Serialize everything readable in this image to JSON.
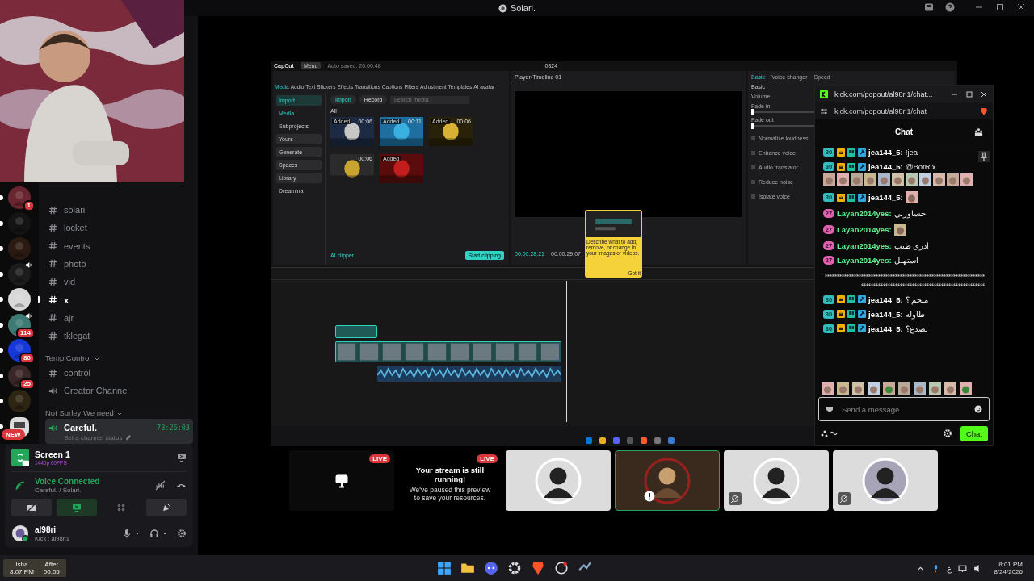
{
  "title_bar": {
    "title": "Solari."
  },
  "servers": [
    {
      "kind": "avatar",
      "badge": "1",
      "speaking": false
    },
    {
      "kind": "avatar",
      "speaking": false
    },
    {
      "kind": "avatar",
      "speaking": false
    },
    {
      "kind": "avatar",
      "speaking": true
    },
    {
      "kind": "avatar",
      "speaking": false
    },
    {
      "kind": "avatar",
      "badge": "114",
      "speaking": true
    },
    {
      "kind": "avatar",
      "badge": "80",
      "speaking": false
    },
    {
      "kind": "avatar",
      "badge": "25",
      "speaking": false
    },
    {
      "kind": "avatar",
      "speaking": false
    },
    {
      "kind": "new",
      "badge": "NEW",
      "speaking": false
    }
  ],
  "channels": [
    {
      "kind": "text",
      "name": "solari",
      "unread": false
    },
    {
      "kind": "text",
      "name": "locket",
      "unread": false
    },
    {
      "kind": "text",
      "name": "events",
      "unread": false
    },
    {
      "kind": "text",
      "name": "photo",
      "unread": false
    },
    {
      "kind": "text",
      "name": "vid",
      "unread": false
    },
    {
      "kind": "text",
      "name": "x",
      "unread": true
    },
    {
      "kind": "text",
      "name": "ajr",
      "unread": false
    },
    {
      "kind": "text",
      "name": "tklegat",
      "unread": false
    },
    {
      "kind": "category",
      "name": "Temp Control"
    },
    {
      "kind": "text",
      "name": "control",
      "unread": false
    },
    {
      "kind": "voice",
      "name": "Creator Channel",
      "connected": false
    },
    {
      "kind": "category",
      "name": "Not Surley We need"
    },
    {
      "kind": "voice",
      "name": "Careful.",
      "connected": true,
      "timer": "73:26:03",
      "status_placeholder": "Set a channel status"
    }
  ],
  "stream_panel": {
    "title": "Screen 1",
    "quality": "1440p 60FPS"
  },
  "voice": {
    "status": "Voice Connected",
    "location": "Careful. / Solari."
  },
  "voice_buttons": [
    {
      "kind": "camera",
      "on": false
    },
    {
      "kind": "screen",
      "on": true
    },
    {
      "kind": "activities",
      "on": false
    },
    {
      "kind": "soundboard",
      "on": false
    }
  ],
  "user": {
    "name": "al98ri",
    "status": "Kick : al98ri1"
  },
  "prayer": {
    "name": "Isha",
    "time": "8:07 PM",
    "label": "After",
    "countdown": "00:05"
  },
  "capcut": {
    "logo": "CapCut",
    "menu": "Menu",
    "autosave": "Auto saved: 20:00:48",
    "project": "0824",
    "tools": [
      {
        "label": "Media",
        "selected": true
      },
      {
        "label": "Audio",
        "selected": false
      },
      {
        "label": "Text",
        "selected": false
      },
      {
        "label": "Stickers",
        "selected": false
      },
      {
        "label": "Effects",
        "selected": false
      },
      {
        "label": "Transitions",
        "selected": false
      },
      {
        "label": "Captions",
        "selected": false
      },
      {
        "label": "Filters",
        "selected": false
      },
      {
        "label": "Adjustment",
        "selected": false
      },
      {
        "label": "Templates",
        "selected": false
      },
      {
        "label": "AI avatar",
        "selected": false
      }
    ],
    "nav": [
      {
        "kind": "group",
        "label": "Import",
        "selected": true
      },
      {
        "kind": "item",
        "label": "Media",
        "selected": true
      },
      {
        "kind": "item",
        "label": "Subprojects",
        "selected": false
      },
      {
        "kind": "group",
        "label": "Yours",
        "selected": false
      },
      {
        "kind": "group",
        "label": "Generate",
        "selected": false
      },
      {
        "kind": "group",
        "label": "Spaces",
        "selected": false
      },
      {
        "kind": "group",
        "label": "Library",
        "selected": false
      },
      {
        "kind": "item",
        "label": "Dreamina",
        "selected": false
      }
    ],
    "import_button": "Import",
    "record_button": "Record",
    "search_placeholder": "Search media",
    "filter": "All",
    "media": [
      {
        "badge": "Added",
        "duration": "00:06"
      },
      {
        "badge": "Added",
        "duration": "00:11"
      },
      {
        "badge": "Added",
        "duration": "00:06"
      },
      {
        "duration": "00:06"
      },
      {
        "badge": "Added"
      }
    ],
    "ai_clipper": "AI clipper",
    "start_clipping": "Start clipping",
    "player_title": "Player-Timeline 01",
    "current_time": "00:00:28:21",
    "total_time": "00:00:29:07",
    "tooltip": {
      "text": "Describe what to add, remove, or change in your images or videos.",
      "button": "Got it"
    },
    "inspector_tabs": [
      {
        "label": "Basic",
        "selected": true
      },
      {
        "label": "Voice changer",
        "selected": false
      },
      {
        "label": "Speed",
        "selected": false
      }
    ],
    "inspector": [
      {
        "kind": "section",
        "label": "Basic"
      },
      {
        "kind": "label",
        "label": "Volume"
      },
      {
        "kind": "slider",
        "label": "Fade in",
        "level": 0
      },
      {
        "kind": "slider",
        "label": "Fade out",
        "level": 0
      },
      {
        "kind": "check",
        "label": "Normalize loudness",
        "checked": false
      },
      {
        "kind": "check",
        "label": "Enhance voice",
        "checked": false
      },
      {
        "kind": "check",
        "label": "Audio translator",
        "checked": false
      },
      {
        "kind": "check",
        "label": "Reduce noise",
        "checked": false
      },
      {
        "kind": "check",
        "label": "Isolate voice",
        "checked": false
      }
    ]
  },
  "chat": {
    "window_title": "kick.com/popout/al98ri1/chat...",
    "url": "kick.com/popout/al98ri1/chat",
    "header": "Chat",
    "messages": [
      {
        "kind": "user",
        "user": "jea144_5:",
        "color": "#ffffff",
        "sub": "30",
        "mod": true,
        "text": "!jea"
      },
      {
        "kind": "user-emote-row",
        "user": "jea144_5:",
        "color": "#ffffff",
        "sub": "30",
        "mod": true,
        "text": "@BotRix"
      },
      {
        "kind": "user-emote",
        "user": "jea144_5:",
        "color": "#ffffff",
        "sub": "30",
        "mod": true
      },
      {
        "kind": "user",
        "user": "Layan2014yes:",
        "color": "#5ef38c",
        "sub": "27",
        "mod": false,
        "text": "حساوربي"
      },
      {
        "kind": "user-emote",
        "user": "Layan2014yes:",
        "color": "#5ef38c",
        "sub": "27",
        "mod": false
      },
      {
        "kind": "user",
        "user": "Layan2014yes:",
        "color": "#5ef38c",
        "sub": "27",
        "mod": false,
        "text": "ادري طيب"
      },
      {
        "kind": "user",
        "user": "Layan2014yes:",
        "color": "#5ef38c",
        "sub": "27",
        "mod": false,
        "text": "استهبل"
      },
      {
        "kind": "plain",
        "text": "ءءءءءءءءءءءءءءءءءءءءءءءءءءءءءءءءءءءءءءءءءءءءءءءءءءءءءءءءءءءءءءءءءءءءءءءءءءءءءءءءءءءءءءءءءءءءءءءءءءءءءءءءءءءءءءءءءءءءء"
      },
      {
        "kind": "user",
        "user": "jea144_5:",
        "color": "#ffffff",
        "sub": "30",
        "mod": true,
        "text": "منجم ؟"
      },
      {
        "kind": "user",
        "user": "jea144_5:",
        "color": "#ffffff",
        "sub": "30",
        "mod": true,
        "text": "طاوله"
      },
      {
        "kind": "user",
        "user": "jea144_5:",
        "color": "#ffffff",
        "sub": "30",
        "mod": true,
        "text": "تصدع؟"
      }
    ],
    "placeholder": "Send a message",
    "send_button": "Chat"
  },
  "tiles": [
    {
      "kind": "screen",
      "live": "LIVE"
    },
    {
      "kind": "paused",
      "live": "LIVE",
      "title": "Your stream is still running!",
      "text": "We've paused this preview to save your resources."
    },
    {
      "kind": "avatar",
      "speaking": false,
      "camera_off": false,
      "alert": false
    },
    {
      "kind": "avatar",
      "speaking": true,
      "camera_off": false,
      "alert": true
    },
    {
      "kind": "avatar",
      "speaking": false,
      "camera_off": true,
      "alert": false
    },
    {
      "kind": "avatar",
      "speaking": false,
      "camera_off": true,
      "alert": false
    }
  ],
  "taskbar": {
    "language": "ع",
    "time": "8:01 PM",
    "date": "8/24/2026"
  }
}
